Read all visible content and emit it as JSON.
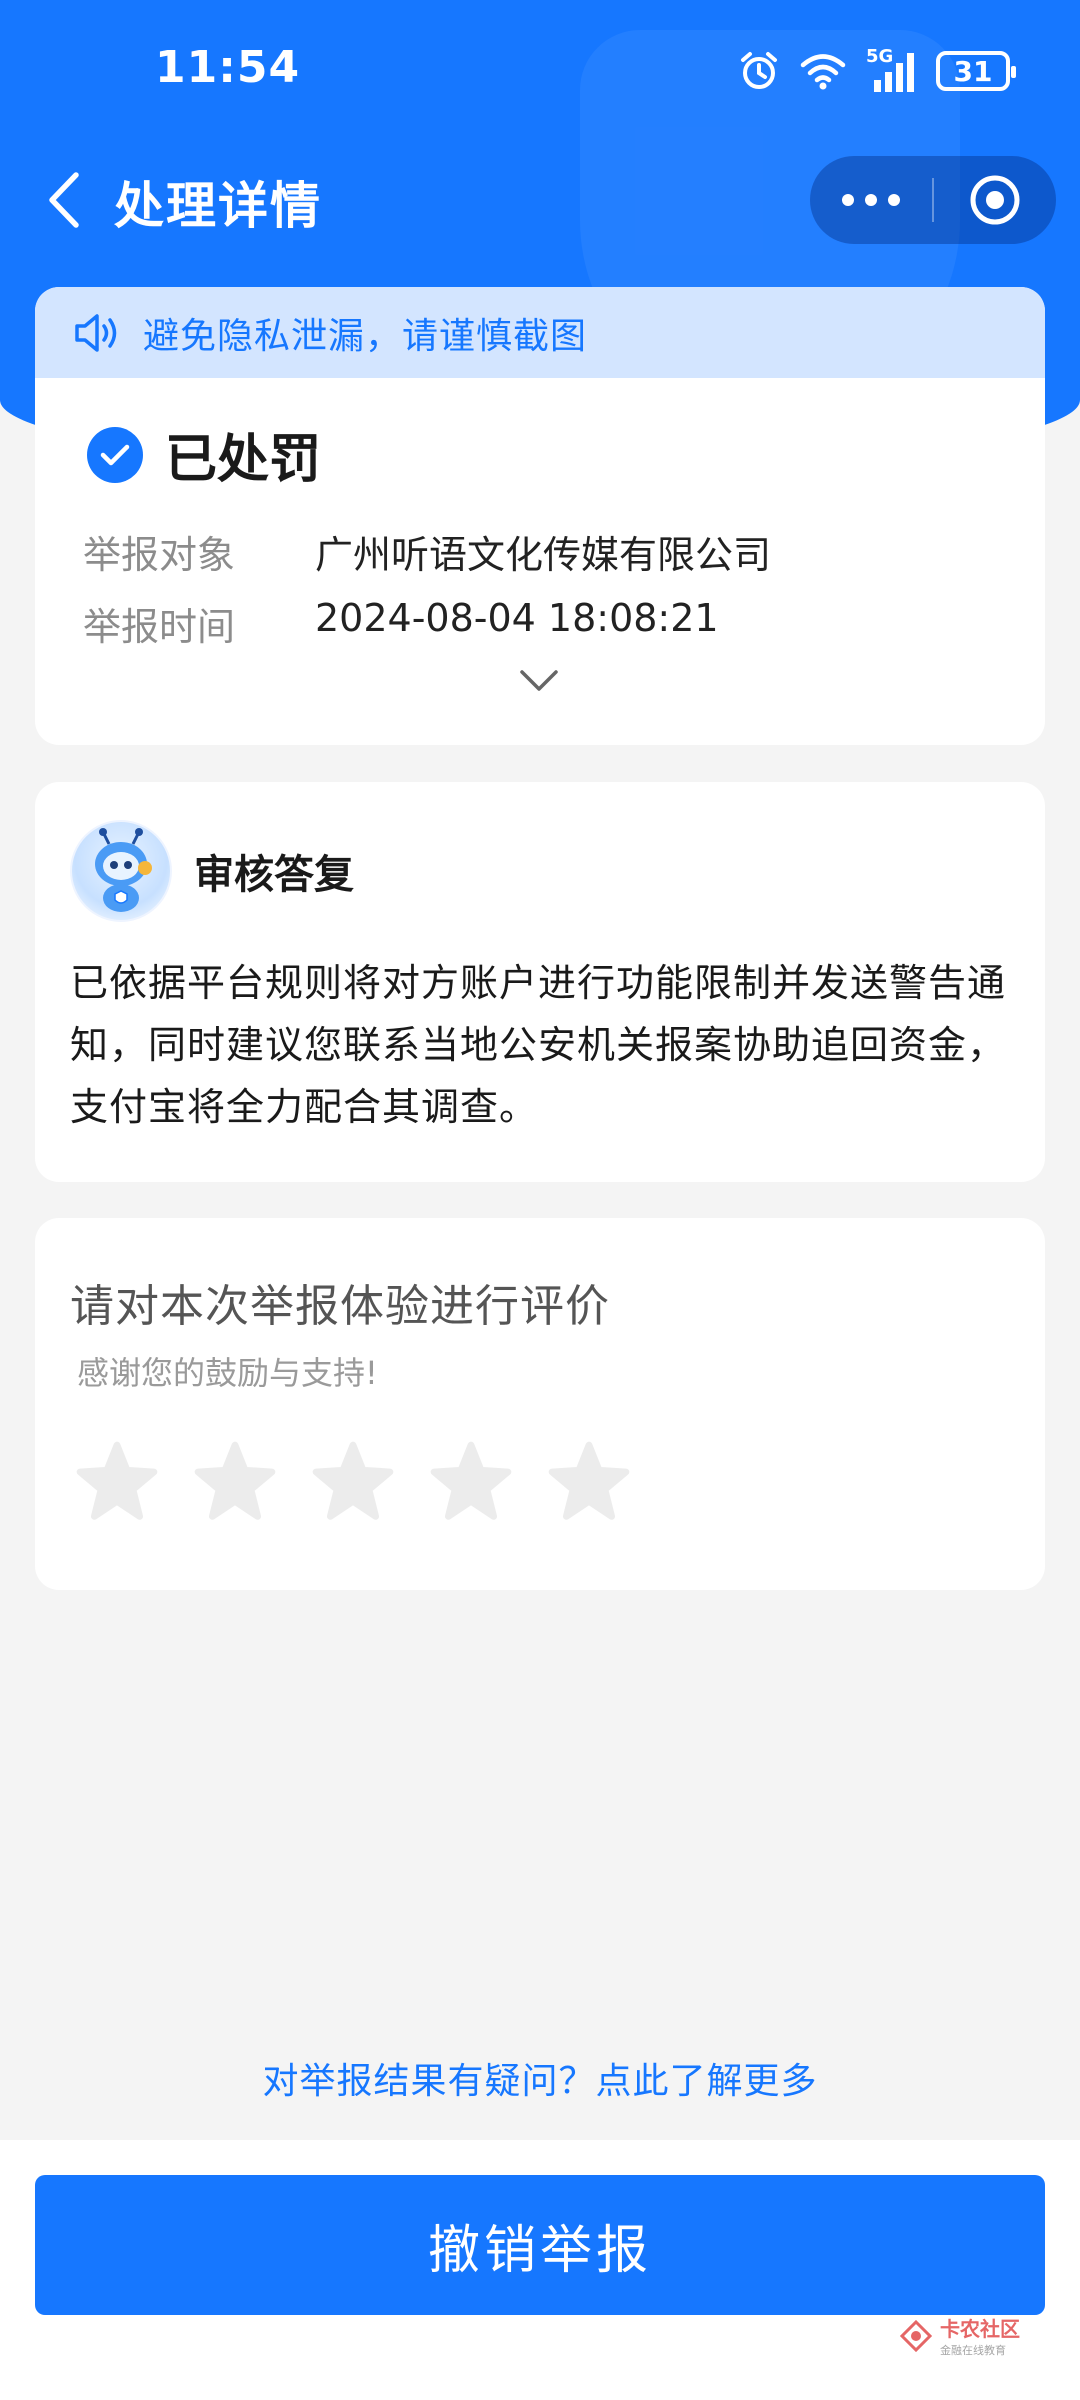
{
  "status_bar": {
    "time": "11:54",
    "network": "5G",
    "battery": "31"
  },
  "nav": {
    "title": "处理详情",
    "icons": [
      "back-arrow-icon",
      "more-dots-icon",
      "target-circle-icon"
    ]
  },
  "status_card": {
    "privacy_notice": "避免隐私泄漏，请谨慎截图",
    "status": "已处罚",
    "report_target_label": "举报对象",
    "report_target_value": "广州听语文化传媒有限公司",
    "report_time_label": "举报时间",
    "report_time_value": "2024-08-04 18:08:21"
  },
  "reply_card": {
    "title": "审核答复",
    "body": "已依据平台规则将对方账户进行功能限制并发送警告通知，同时建议您联系当地公安机关报案协助追回资金，支付宝将全力配合其调查。"
  },
  "rating_card": {
    "title": "请对本次举报体验进行评价",
    "subtitle": "感谢您的鼓励与支持!",
    "star_count": 5,
    "rating": 0
  },
  "help_link": "对举报结果有疑问？点此了解更多",
  "revoke_button": "撤销举报",
  "watermark": {
    "main": "卡农社区",
    "sub": "金融在线教育"
  },
  "colors": {
    "primary": "#1677ff",
    "banner": "#d3e5ff",
    "star_empty": "#ececec",
    "background": "#f4f4f4"
  }
}
